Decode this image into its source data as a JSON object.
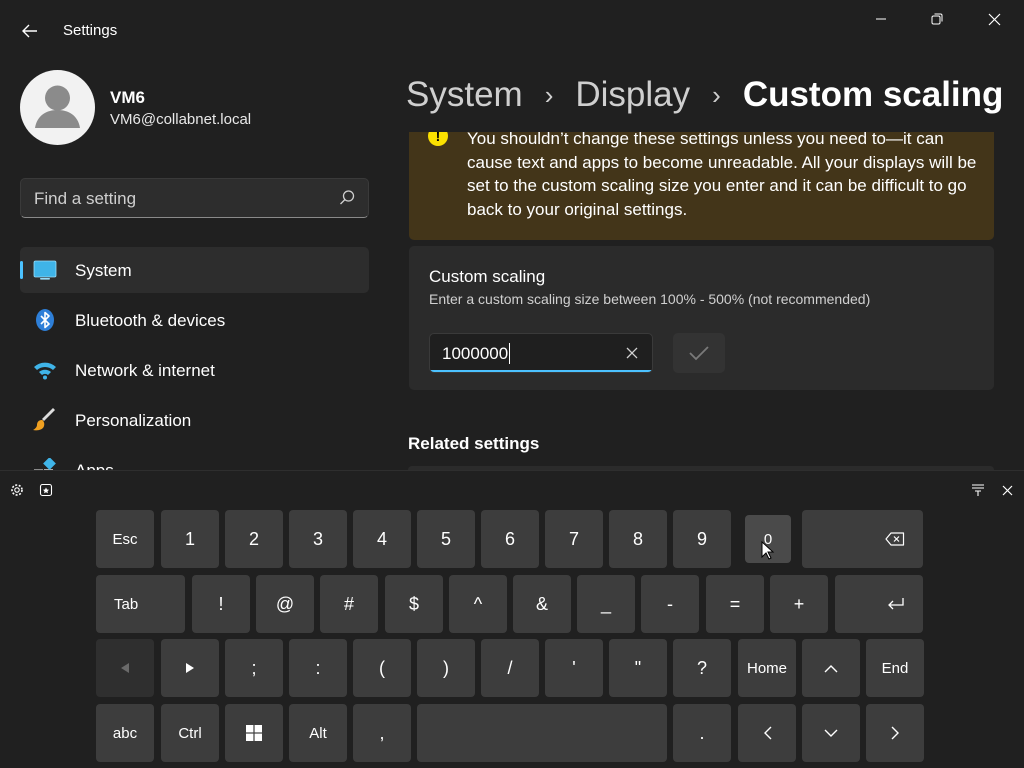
{
  "window": {
    "app_title": "Settings",
    "icons": {
      "back": "back-arrow-icon",
      "minimize": "minimize-icon",
      "maximize": "restore-icon",
      "close": "close-icon"
    }
  },
  "profile": {
    "name": "VM6",
    "email": "VM6@collabnet.local"
  },
  "search": {
    "placeholder": "Find a setting"
  },
  "sidebar": {
    "items": [
      {
        "label": "System",
        "icon": "monitor-icon",
        "selected": true
      },
      {
        "label": "Bluetooth & devices",
        "icon": "bluetooth-icon",
        "selected": false
      },
      {
        "label": "Network & internet",
        "icon": "wifi-icon",
        "selected": false
      },
      {
        "label": "Personalization",
        "icon": "brush-icon",
        "selected": false
      },
      {
        "label": "Apps",
        "icon": "apps-icon",
        "selected": false
      }
    ]
  },
  "breadcrumb": {
    "items": [
      "System",
      "Display",
      "Custom scaling"
    ],
    "separator": "›"
  },
  "warning": {
    "text": "You shouldn’t change these settings unless you need to—it can cause text and apps to become unreadable. All your displays will be set to the custom scaling size you enter and it can be difficult to go back to your original settings."
  },
  "custom_scaling": {
    "title": "Custom scaling",
    "description": "Enter a custom scaling size between 100% - 500% (not recommended)",
    "value": "1000000"
  },
  "related": {
    "heading": "Related settings"
  },
  "keyboard": {
    "rows": [
      [
        "Esc",
        "1",
        "2",
        "3",
        "4",
        "5",
        "6",
        "7",
        "8",
        "9",
        "0",
        "⌫"
      ],
      [
        "Tab",
        "!",
        "@",
        "#",
        "$",
        "^",
        "&",
        "_",
        "-",
        "=",
        "+",
        "↵"
      ],
      [
        "◀",
        "▶",
        ";",
        ":",
        "(",
        ")",
        "/",
        "'",
        "\"",
        "?",
        "Home",
        "^",
        "End"
      ],
      [
        "abc",
        "Ctrl",
        "⊞",
        "Alt",
        ",",
        "",
        ".",
        "<",
        "˅",
        ">"
      ]
    ],
    "pressed_key": "0"
  },
  "colors": {
    "accent": "#4cc2ff",
    "background": "#202020",
    "card": "#2b2b2b",
    "warning_card": "#433519",
    "warning_icon": "#fce100",
    "key": "#3d3d3d"
  }
}
